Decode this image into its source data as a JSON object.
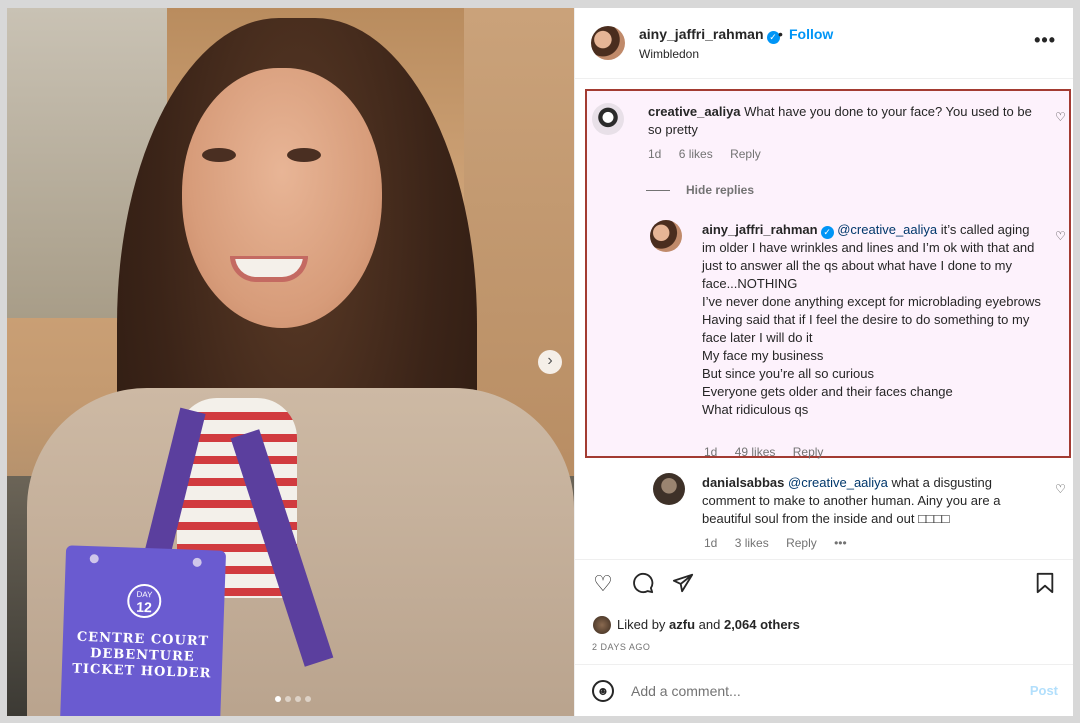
{
  "media": {
    "badge": {
      "day_label": "DAY",
      "day_number": "12",
      "title_line1": "CENTRE COURT",
      "title_line2": "DEBENTURE",
      "title_line3": "TICKET HOLDER"
    },
    "carousel_dots": 4,
    "carousel_active": 0
  },
  "header": {
    "username": "ainy_jaffri_rahman",
    "separator": "•",
    "follow_label": "Follow",
    "location": "Wimbledon",
    "more_label": "•••"
  },
  "comments": [
    {
      "username": "creative_aaliya",
      "text": "What have you done to your face? You used to be so pretty",
      "time": "1d",
      "likes": "6 likes",
      "reply_label": "Reply"
    }
  ],
  "hide_replies_label": "Hide replies",
  "reply": {
    "username": "ainy_jaffri_rahman",
    "mention": "@creative_aaliya",
    "lines": [
      " it’s called aging im older I have wrinkles and lines and I’m ok with that and just to answer all the qs about what have I done to my face...NOTHING",
      "I’ve never done anything except for microblading eyebrows",
      "Having said that if I feel the desire to do something to my face later I will do it",
      "My face my business",
      "But since you’re all so curious",
      "Everyone gets older and their faces change",
      "What ridiculous qs"
    ],
    "time": "1d",
    "likes": "49 likes",
    "reply_label": "Reply"
  },
  "reply2": {
    "username": "danialsabbas",
    "mention": "@creative_aaliya",
    "text": " what a disgusting comment to make to another human. Ainy you are a beautiful soul from the inside and out □□□□",
    "time": "1d",
    "likes": "3 likes",
    "reply_label": "Reply",
    "more_label": "•••"
  },
  "likes": {
    "prefix": "Liked by ",
    "user": "azfu",
    "middle": " and ",
    "others": "2,064 others"
  },
  "date": "2 DAYS AGO",
  "comment_bar": {
    "placeholder": "Add a comment...",
    "post_label": "Post"
  },
  "colors": {
    "accent": "#0095f6",
    "highlight_border": "#a33b32",
    "highlight_bg": "#fdf2fc"
  }
}
